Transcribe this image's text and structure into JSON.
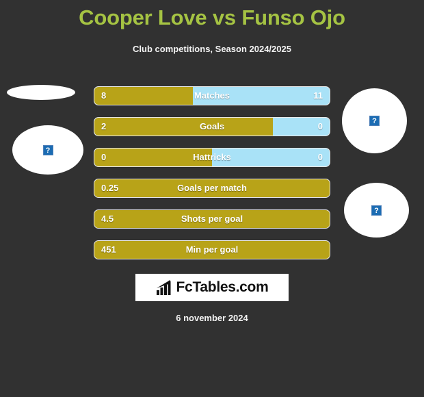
{
  "header": {
    "title": "Cooper Love vs Funso Ojo",
    "subtitle": "Club competitions, Season 2024/2025",
    "title_color": "#a5c343"
  },
  "colors": {
    "background": "#313131",
    "home_bar": "#b8a318",
    "away_bar": "#a9e2f7",
    "text": "#ffffff"
  },
  "players": {
    "home": {
      "name": "Cooper Love",
      "avatar_alt": "?"
    },
    "away": {
      "name": "Funso Ojo",
      "avatar_alt": "?"
    }
  },
  "chart_data": {
    "type": "bar",
    "title": "Cooper Love vs Funso Ojo",
    "subtitle": "Club competitions, Season 2024/2025",
    "orientation": "horizontal-diverging",
    "categories": [
      "Matches",
      "Goals",
      "Hattricks",
      "Goals per match",
      "Shots per goal",
      "Min per goal"
    ],
    "series": [
      {
        "name": "Cooper Love",
        "color": "#b8a318",
        "values": [
          "8",
          "2",
          "0",
          "0.25",
          "4.5",
          "451"
        ]
      },
      {
        "name": "Funso Ojo",
        "color": "#a9e2f7",
        "values": [
          "11",
          "0",
          "0",
          "",
          "",
          ""
        ]
      }
    ],
    "fill_percent": [
      42,
      76,
      50,
      100,
      100,
      100
    ],
    "legend": "position: avatars left (Cooper Love) and right (Funso Ojo)"
  },
  "rows": [
    {
      "label": "Matches",
      "left": "8",
      "right": "11",
      "fill": 42,
      "split": true
    },
    {
      "label": "Goals",
      "left": "2",
      "right": "0",
      "fill": 76,
      "split": true
    },
    {
      "label": "Hattricks",
      "left": "0",
      "right": "0",
      "fill": 50,
      "split": true
    },
    {
      "label": "Goals per match",
      "left": "0.25",
      "right": "",
      "fill": 100,
      "split": false
    },
    {
      "label": "Shots per goal",
      "left": "4.5",
      "right": "",
      "fill": 100,
      "split": false
    },
    {
      "label": "Min per goal",
      "left": "451",
      "right": "",
      "fill": 100,
      "split": false
    }
  ],
  "footer": {
    "logo_text": "FcTables.com",
    "date": "6 november 2024"
  }
}
